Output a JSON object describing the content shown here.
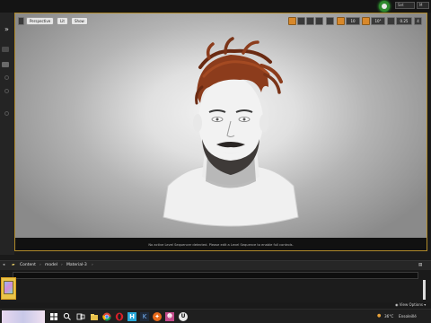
{
  "header": {
    "badge_icon": "unreal-engine-icon",
    "right_buttons": [
      "Set",
      "M"
    ]
  },
  "viewport": {
    "toolbar_left": [
      "Perspective",
      "Lit",
      "Show"
    ],
    "camera_speed": "4",
    "grid_value": "10",
    "rotation_value": "10°",
    "scale_value": "0.25",
    "message": "No active Level Sequencer detected. Please edit a Level Sequence to enable full controls."
  },
  "content_browser": {
    "breadcrumbs": [
      "Content",
      "model",
      "Material-3"
    ],
    "view_options": "View Options"
  },
  "taskbar": {
    "temperature": "36°C",
    "weather": "Ensoleillé",
    "apps": [
      "start",
      "search",
      "task-view",
      "file-explorer",
      "chrome",
      "opera",
      "app-h",
      "app-k",
      "app-x",
      "app-u",
      "unreal-engine"
    ]
  },
  "colors": {
    "accent_gold": "#b08a2a",
    "hair": "#8c3c1c",
    "skin": "#eeeeee"
  }
}
